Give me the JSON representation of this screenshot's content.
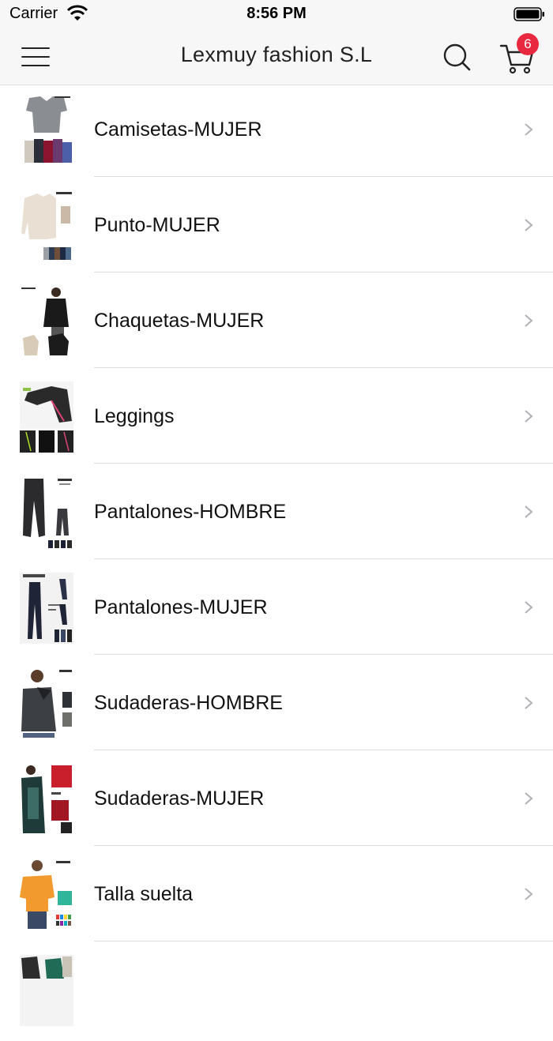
{
  "status_bar": {
    "carrier": "Carrier",
    "time": "8:56 PM"
  },
  "nav": {
    "title": "Lexmuy fashion S.L",
    "menu_icon": "hamburger-menu-icon",
    "search_icon": "search-icon",
    "cart_icon": "shopping-cart-icon",
    "cart_count": "6"
  },
  "colors": {
    "badge": "#e8283f",
    "bar_background": "#f7f7f7",
    "divider": "#dcdcdc",
    "chevron": "#c7c7cc"
  },
  "categories": [
    {
      "label": "Camisetas-MUJER"
    },
    {
      "label": "Punto-MUJER"
    },
    {
      "label": "Chaquetas-MUJER"
    },
    {
      "label": "Leggings"
    },
    {
      "label": "Pantalones-HOMBRE"
    },
    {
      "label": "Pantalones-MUJER"
    },
    {
      "label": "Sudaderas-HOMBRE"
    },
    {
      "label": "Sudaderas-MUJER"
    },
    {
      "label": "Talla suelta"
    },
    {
      "label": ""
    }
  ]
}
